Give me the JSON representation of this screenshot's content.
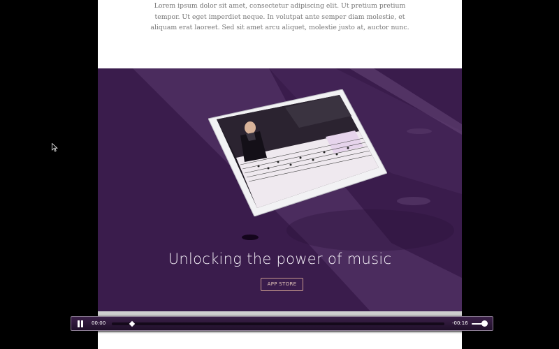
{
  "intro": {
    "paragraph": "Lorem ipsum dolor sit amet, consectetur adipiscing elit. Ut pretium pretium tempor. Ut eget imperdiet neque. In volutpat ante semper diam molestie, et aliquam erat laoreet. Sed sit amet arcu aliquet, molestie justo at, auctor nunc."
  },
  "hero": {
    "title": "Unlocking the power of music",
    "button_label": "APP STORE",
    "background_color": "#3a1c4c",
    "accent_color": "#c79a8e"
  },
  "player": {
    "elapsed": "00:00",
    "remaining": "-00:16",
    "progress": 0.06,
    "volume": 0.85
  }
}
